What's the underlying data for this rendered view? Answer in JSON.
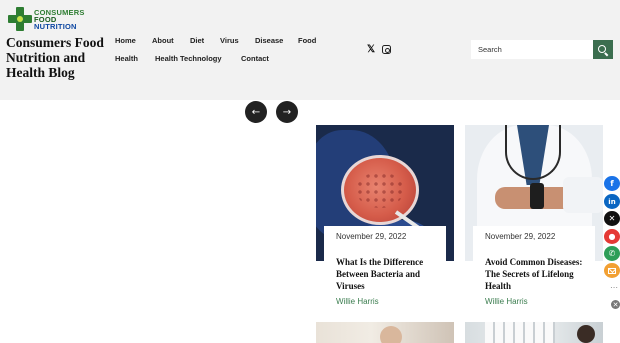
{
  "logo": {
    "line1": "CONSUMERS",
    "line2": "FOOD",
    "line3": "NUTRITION"
  },
  "site": {
    "title": "Consumers Food Nutrition and Health Blog"
  },
  "nav": {
    "items": [
      "Home",
      "About",
      "Diet",
      "Virus",
      "Disease",
      "Food",
      "Health",
      "Health Technology",
      "Contact"
    ]
  },
  "social": {
    "x_icon": "x-icon",
    "instagram_icon": "instagram-icon"
  },
  "search": {
    "placeholder": "Search",
    "button_icon": "search-icon"
  },
  "slider": {
    "prev_glyph": "←",
    "next_glyph": "→"
  },
  "posts": [
    {
      "date": "November 29, 2022",
      "title": "What Is the Difference Between Bacteria and Viruses",
      "author": "Willie Harris"
    },
    {
      "date": "November 29, 2022",
      "title": "Avoid Common Diseases: The Secrets of Lifelong Health",
      "author": "Willie Harris"
    }
  ],
  "share": {
    "facebook": "f",
    "linkedin": "in",
    "x": "✕",
    "reddit": "●",
    "whatsapp": "✆",
    "more": "⋯",
    "close": "✕"
  },
  "colors": {
    "accent": "#3b6e4f",
    "header_bg": "#f2f2f2",
    "author": "#3b7d4f"
  }
}
